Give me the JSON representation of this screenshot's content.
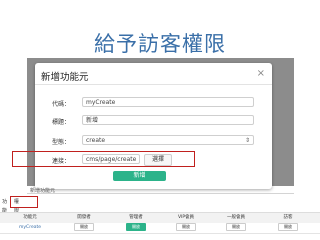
{
  "slide": {
    "title": "給予訪客權限"
  },
  "modal": {
    "title": "新增功能元",
    "close_label": "×",
    "fields": {
      "code": {
        "label": "代碼：",
        "value": "myCreate"
      },
      "heading": {
        "label": "標題：",
        "value": "新增"
      },
      "type": {
        "label": "型態：",
        "value": "create",
        "chevron": "⇕"
      },
      "link": {
        "label": "連接：",
        "value": "cms/page/create",
        "select_label": "選擇"
      }
    },
    "submit_label": "新增"
  },
  "background": {
    "below_text": "新增功能元"
  },
  "tabs": [
    {
      "label": "功能元"
    },
    {
      "label": "權限設定"
    }
  ],
  "table": {
    "headers": [
      "功能元",
      "開發者",
      "管理者",
      "VIP會員",
      "一般會員",
      "訪客"
    ],
    "rows": [
      {
        "name": "myCreate",
        "cells": [
          "開放",
          "開放",
          "開放",
          "開放",
          "開放"
        ]
      }
    ]
  },
  "colors": {
    "title": "#3a6fa8",
    "highlight": "#c0201e",
    "primary_button": "#2cb38a"
  }
}
